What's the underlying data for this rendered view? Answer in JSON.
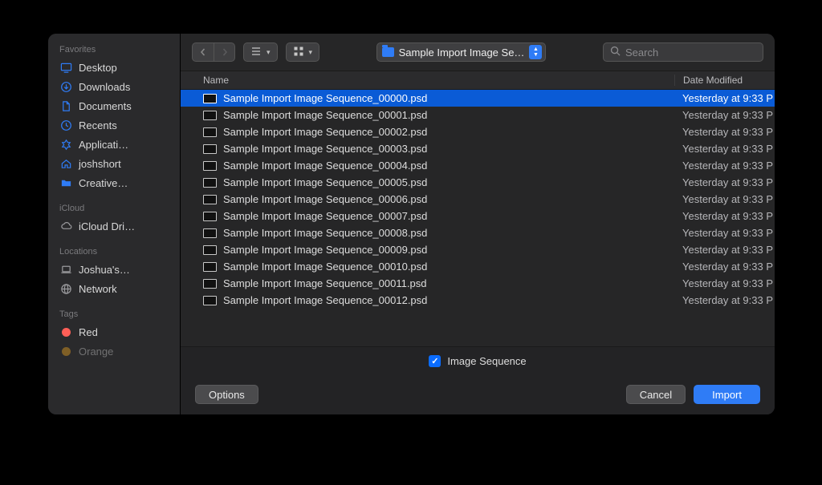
{
  "sidebar": {
    "sections": {
      "favorites": {
        "title": "Favorites",
        "items": [
          {
            "label": "Desktop"
          },
          {
            "label": "Downloads"
          },
          {
            "label": "Documents"
          },
          {
            "label": "Recents"
          },
          {
            "label": "Applicati…"
          },
          {
            "label": "joshshort"
          },
          {
            "label": "Creative…"
          }
        ]
      },
      "icloud": {
        "title": "iCloud",
        "items": [
          {
            "label": "iCloud Dri…"
          }
        ]
      },
      "locations": {
        "title": "Locations",
        "items": [
          {
            "label": "Joshua's…"
          },
          {
            "label": "Network"
          }
        ]
      },
      "tags": {
        "title": "Tags",
        "items": [
          {
            "label": "Red",
            "color": "#ff5f57"
          },
          {
            "label": "Orange",
            "color": "#ffb01f"
          }
        ]
      }
    }
  },
  "toolbar": {
    "path_label": "Sample Import Image Se…",
    "search_placeholder": "Search"
  },
  "columns": {
    "name": "Name",
    "date": "Date Modified"
  },
  "files": [
    {
      "name": "Sample Import Image Sequence_00000.psd",
      "date": "Yesterday at 9:33 P",
      "selected": true
    },
    {
      "name": "Sample Import Image Sequence_00001.psd",
      "date": "Yesterday at 9:33 P"
    },
    {
      "name": "Sample Import Image Sequence_00002.psd",
      "date": "Yesterday at 9:33 P"
    },
    {
      "name": "Sample Import Image Sequence_00003.psd",
      "date": "Yesterday at 9:33 P"
    },
    {
      "name": "Sample Import Image Sequence_00004.psd",
      "date": "Yesterday at 9:33 P"
    },
    {
      "name": "Sample Import Image Sequence_00005.psd",
      "date": "Yesterday at 9:33 P"
    },
    {
      "name": "Sample Import Image Sequence_00006.psd",
      "date": "Yesterday at 9:33 P"
    },
    {
      "name": "Sample Import Image Sequence_00007.psd",
      "date": "Yesterday at 9:33 P"
    },
    {
      "name": "Sample Import Image Sequence_00008.psd",
      "date": "Yesterday at 9:33 P"
    },
    {
      "name": "Sample Import Image Sequence_00009.psd",
      "date": "Yesterday at 9:33 P"
    },
    {
      "name": "Sample Import Image Sequence_00010.psd",
      "date": "Yesterday at 9:33 P"
    },
    {
      "name": "Sample Import Image Sequence_00011.psd",
      "date": "Yesterday at 9:33 P"
    },
    {
      "name": "Sample Import Image Sequence_00012.psd",
      "date": "Yesterday at 9:33 P"
    }
  ],
  "options": {
    "image_sequence_label": "Image Sequence",
    "options_button": "Options"
  },
  "footer": {
    "cancel": "Cancel",
    "import": "Import"
  }
}
